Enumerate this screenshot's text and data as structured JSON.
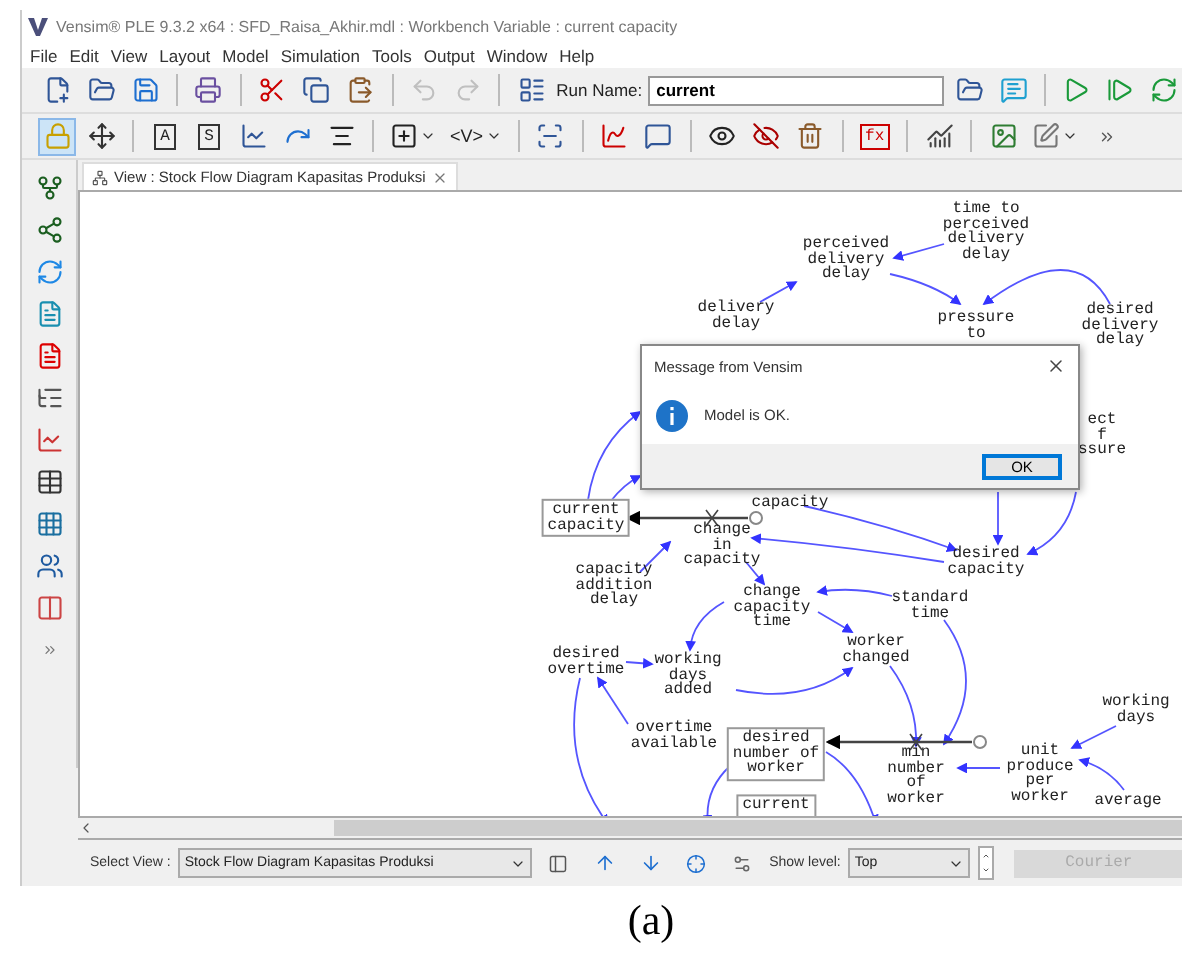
{
  "window": {
    "title": "Vensim® PLE 9.3.2 x64 : SFD_Raisa_Akhir.mdl : Workbench Variable : current capacity"
  },
  "menu": [
    "File",
    "Edit",
    "View",
    "Layout",
    "Model",
    "Simulation",
    "Tools",
    "Output",
    "Window",
    "Help"
  ],
  "toolbar": {
    "undo_disabled": true,
    "redo_disabled": true,
    "run_name_label": "Run Name:",
    "run_name": "current"
  },
  "sketch_tool_groups": [
    {
      "tools": [
        {
          "kind": "lock",
          "selected": true
        },
        {
          "kind": "move",
          "selected": false
        }
      ]
    },
    {
      "tools": [
        {
          "kind": "boxed",
          "label": "A",
          "selected": false
        },
        {
          "kind": "boxed",
          "label": "S",
          "selected": false
        },
        {
          "kind": "line-chart",
          "selected": false
        },
        {
          "kind": "arrow",
          "selected": false
        },
        {
          "kind": "rate",
          "selected": false
        }
      ]
    },
    {
      "tools": [
        {
          "kind": "shadow",
          "selected": false,
          "menu": true
        },
        {
          "kind": "text",
          "label": "<V>",
          "selected": false,
          "menu": true
        }
      ]
    },
    {
      "tools": [
        {
          "kind": "merge",
          "selected": false
        }
      ]
    },
    {
      "tools": [
        {
          "kind": "graph",
          "selected": false
        },
        {
          "kind": "comment",
          "selected": false
        }
      ]
    },
    {
      "tools": [
        {
          "kind": "eye",
          "selected": false
        },
        {
          "kind": "eye-off",
          "selected": false
        },
        {
          "kind": "delete",
          "selected": false
        }
      ]
    },
    {
      "tools": [
        {
          "kind": "boxed-red",
          "label": "fx",
          "selected": false
        }
      ]
    },
    {
      "tools": [
        {
          "kind": "chart",
          "selected": false
        }
      ]
    },
    {
      "tools": [
        {
          "kind": "image",
          "selected": false
        },
        {
          "kind": "edit",
          "selected": false,
          "menu": true
        }
      ]
    }
  ],
  "view_tab": {
    "label": "View : Stock Flow Diagram Kapasitas Produksi",
    "selected": true
  },
  "diagram": {
    "nodes": [
      {
        "kind": "variable",
        "text": "time to\nperceived\ndelivery\ndelay"
      },
      {
        "kind": "variable",
        "text": "perceived\ndelivery\ndelay"
      },
      {
        "kind": "variable",
        "text": "delivery\ndelay"
      },
      {
        "kind": "variable",
        "text": "pressure\nto"
      },
      {
        "kind": "variable",
        "text": "desired\ndelivery\ndelay"
      },
      {
        "kind": "variable",
        "text": "ect\nf\nssure"
      },
      {
        "kind": "variable",
        "text": "capacity"
      },
      {
        "kind": "stock",
        "text": "current\ncapacity"
      },
      {
        "kind": "variable",
        "text": "change\nin\ncapacity"
      },
      {
        "kind": "variable",
        "text": "capacity\naddition\ndelay"
      },
      {
        "kind": "variable",
        "text": "desired\ncapacity"
      },
      {
        "kind": "variable",
        "text": "change\ncapacity\ntime"
      },
      {
        "kind": "variable",
        "text": "standard\ntime"
      },
      {
        "kind": "variable",
        "text": "worker\nchanged"
      },
      {
        "kind": "variable",
        "text": "desired\novertime"
      },
      {
        "kind": "variable",
        "text": "working\ndays\nadded"
      },
      {
        "kind": "variable",
        "text": "overtime\navailable"
      },
      {
        "kind": "stock",
        "text": "desired\nnumber of\nworker"
      },
      {
        "kind": "variable",
        "text": "min\nnumber\nof\nworker"
      },
      {
        "kind": "variable",
        "text": "unit\nproduce\nper\nworker"
      },
      {
        "kind": "variable",
        "text": "working\ndays"
      },
      {
        "kind": "stock",
        "text": "current"
      },
      {
        "kind": "variable",
        "text": "average"
      }
    ]
  },
  "dialog": {
    "title": "Message from Vensim",
    "message": "Model is OK.",
    "button": "OK"
  },
  "bottom_bar": {
    "select_view_label": "Select View :",
    "view": "Stock Flow Diagram Kapasitas Produksi",
    "show_level_label": "Show level:",
    "level": "Top",
    "font_button": "Courier",
    "font_button_disabled": true
  },
  "caption": "(a)"
}
